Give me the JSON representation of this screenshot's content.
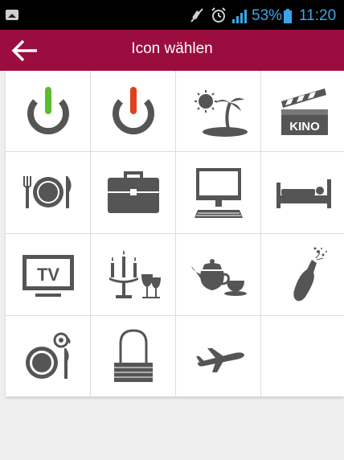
{
  "status_bar": {
    "battery_percent": "53%",
    "time": "11:20",
    "icons": [
      "screenshot-icon",
      "mute-icon",
      "alarm-icon",
      "signal-icon",
      "battery-icon"
    ],
    "accent": "#3aa6e8"
  },
  "app_bar": {
    "title": "Icon wählen",
    "back_icon": "arrow-left-icon",
    "color": "#9b0d3e"
  },
  "icons": [
    {
      "name": "power-on-icon",
      "accent": "#5dbb2e"
    },
    {
      "name": "power-off-icon",
      "accent": "#e1401c"
    },
    {
      "name": "vacation-icon"
    },
    {
      "name": "cinema-icon",
      "label": "KINO"
    },
    {
      "name": "dining-icon"
    },
    {
      "name": "briefcase-icon"
    },
    {
      "name": "computer-icon"
    },
    {
      "name": "bed-icon"
    },
    {
      "name": "tv-icon",
      "label": "TV"
    },
    {
      "name": "candlelight-dinner-icon"
    },
    {
      "name": "tea-icon"
    },
    {
      "name": "champagne-icon"
    },
    {
      "name": "breakfast-icon"
    },
    {
      "name": "shopping-bag-icon"
    },
    {
      "name": "airplane-icon"
    }
  ],
  "icon_color": "#555555"
}
